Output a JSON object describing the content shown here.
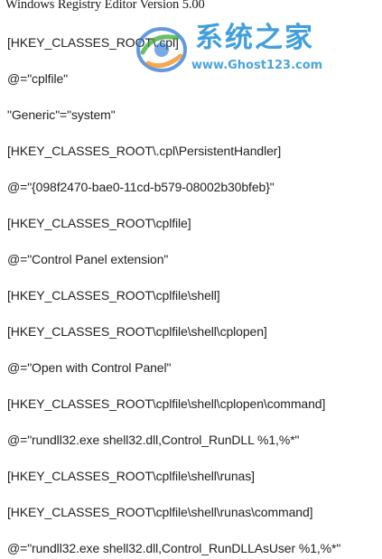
{
  "document": {
    "header": "Windows Registry Editor Version 5.00",
    "lines": [
      "[HKEY_CLASSES_ROOT\\.cpl]",
      "@=\"cplfile\"",
      "\"Generic\"=\"system\"",
      "[HKEY_CLASSES_ROOT\\.cpl\\PersistentHandler]",
      "@=\"{098f2470-bae0-11cd-b579-08002b30bfeb}\"",
      "[HKEY_CLASSES_ROOT\\cplfile]",
      "@=\"Control Panel extension\"",
      "[HKEY_CLASSES_ROOT\\cplfile\\shell]",
      "[HKEY_CLASSES_ROOT\\cplfile\\shell\\cplopen]",
      "@=\"Open with Control Panel\"",
      "[HKEY_CLASSES_ROOT\\cplfile\\shell\\cplopen\\command]",
      "@=\"rundll32.exe shell32.dll,Control_RunDLL %1,%*\"",
      "[HKEY_CLASSES_ROOT\\cplfile\\shell\\runas]",
      "[HKEY_CLASSES_ROOT\\cplfile\\shell\\runas\\command]",
      "@=\"rundll32.exe shell32.dll,Control_RunDLLAsUser %1,%*\""
    ]
  },
  "watermark": {
    "title": "系统之家",
    "url": "www.Ghost123.com",
    "colors": {
      "primary": "#1f8fd6",
      "logo_blue": "#1e6fd0",
      "logo_green": "#3aa935",
      "logo_orange": "#f08a1c"
    }
  }
}
